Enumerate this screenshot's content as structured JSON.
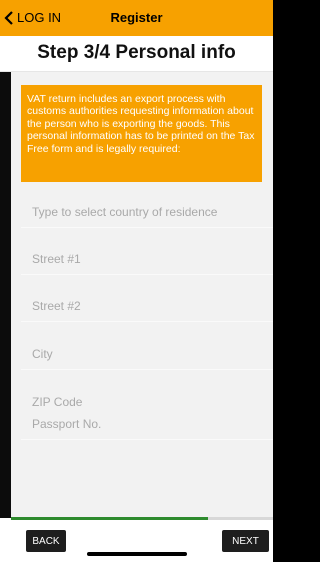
{
  "nav": {
    "back_label": "LOG IN",
    "title": "Register"
  },
  "heading": "Step 3/4 Personal info",
  "notice": "VAT return includes an export process with customs authorities requesting information about the person who is exporting the goods. This personal information has to be printed on the Tax Free form and is legally required:",
  "fields": [
    {
      "placeholder": "Type to select country of residence",
      "value": ""
    },
    {
      "placeholder": "Street #1",
      "value": ""
    },
    {
      "placeholder": "Street #2",
      "value": ""
    },
    {
      "placeholder": "City",
      "value": ""
    },
    {
      "placeholder": "ZIP Code",
      "value": ""
    },
    {
      "placeholder": "Passport No.",
      "value": ""
    }
  ],
  "progress": 0.75,
  "buttons": {
    "back": "BACK",
    "next": "NEXT"
  },
  "colors": {
    "accent": "#F7A100",
    "progress": "#2E8B2E"
  }
}
